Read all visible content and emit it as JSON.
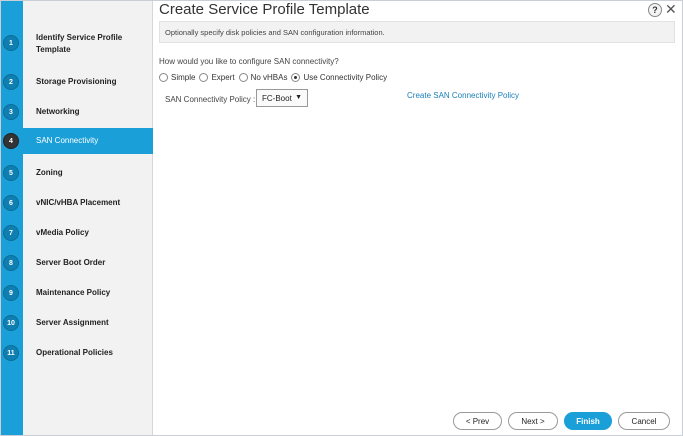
{
  "window": {
    "title": "Create Service Profile Template",
    "help_label": "?",
    "close_label": "✕"
  },
  "steps": [
    {
      "num": "1",
      "label": "Identify Service Profile Template"
    },
    {
      "num": "2",
      "label": "Storage Provisioning"
    },
    {
      "num": "3",
      "label": "Networking"
    },
    {
      "num": "4",
      "label": "SAN Connectivity"
    },
    {
      "num": "5",
      "label": "Zoning"
    },
    {
      "num": "6",
      "label": "vNIC/vHBA Placement"
    },
    {
      "num": "7",
      "label": "vMedia Policy"
    },
    {
      "num": "8",
      "label": "Server Boot Order"
    },
    {
      "num": "9",
      "label": "Maintenance Policy"
    },
    {
      "num": "10",
      "label": "Server Assignment"
    },
    {
      "num": "11",
      "label": "Operational Policies"
    }
  ],
  "active_step": "SAN Connectivity",
  "main": {
    "info": "Optionally specify disk policies and SAN configuration information.",
    "question": "How would you like to configure SAN connectivity?",
    "options": [
      {
        "label": "Simple",
        "checked": false
      },
      {
        "label": "Expert",
        "checked": false
      },
      {
        "label": "No vHBAs",
        "checked": false
      },
      {
        "label": "Use Connectivity Policy",
        "checked": true
      }
    ],
    "policy_label": "SAN Connectivity Policy :",
    "policy_value": "FC-Boot",
    "policy_arrow": "▼",
    "create_link": "Create SAN Connectivity Policy"
  },
  "footer": {
    "prev": "< Prev",
    "next": "Next >",
    "finish": "Finish",
    "cancel": "Cancel"
  },
  "colors": {
    "accent": "#1a9fd8",
    "link": "#1a7fb8",
    "step_circle": "#0f7fb2"
  }
}
